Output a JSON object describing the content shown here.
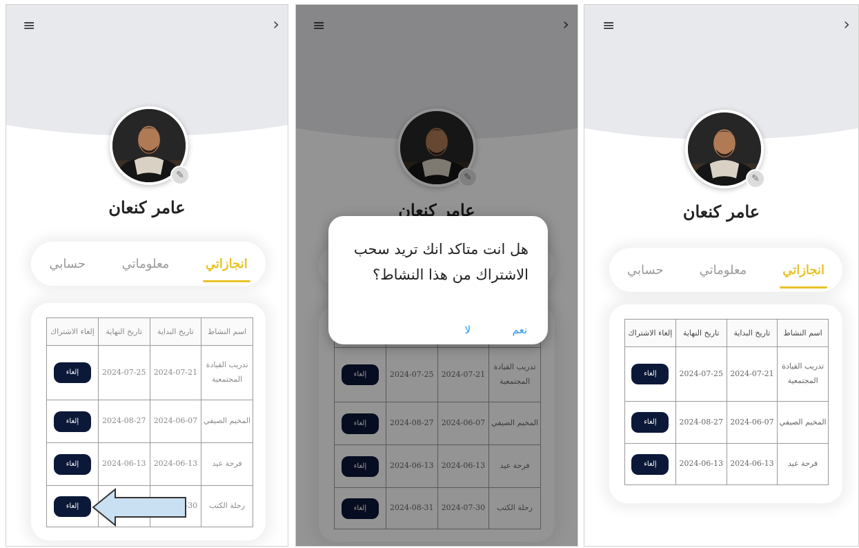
{
  "profile": {
    "name": "عامر كنعان",
    "menu_icon": "≡",
    "back_icon": "›",
    "edit_icon": "✎"
  },
  "tabs": {
    "account": "حسابي",
    "info": "معلوماتي",
    "achievements": "انجازاتي"
  },
  "table": {
    "headers": [
      "اسم النشاط",
      "تاريخ البداية",
      "تاريخ النهاية",
      "إلغاء الاشتراك"
    ],
    "cancel_label": "إلغاء",
    "rows": [
      {
        "activity": "تدريب القيادة المجتمعية",
        "start": "2024-07-21",
        "end": "2024-07-25"
      },
      {
        "activity": "المخيم الصيفي",
        "start": "2024-06-07",
        "end": "2024-08-27"
      },
      {
        "activity": "فرحة عيد",
        "start": "2024-06-13",
        "end": "2024-06-13"
      },
      {
        "activity": "رحلة الكتب",
        "start": "2024-07-30",
        "end": "2024-08-31"
      }
    ]
  },
  "dialog": {
    "message": "هل انت متاكد انك تريد سحب الاشتراك من هذا النشاط؟",
    "yes_label": "نعم",
    "no_label": "لا"
  },
  "colors": {
    "accent": "#e8c227",
    "button_dark": "#0b1838",
    "dialog_action": "#2196f3",
    "header_bg": "#e8e9ec"
  }
}
